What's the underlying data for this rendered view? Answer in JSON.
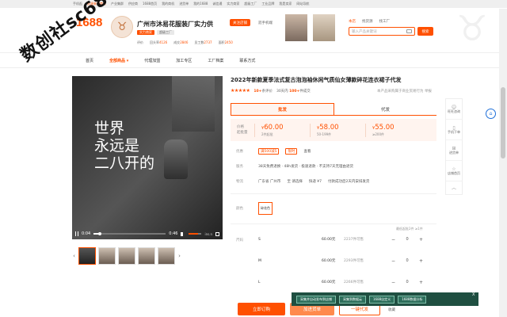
{
  "topbar": {
    "items": [
      "手机逛",
      "资源来源商家",
      "产业集群",
      "供应商",
      "1688首页",
      "我的商机",
      "进货单",
      "我的1688",
      "诚信通",
      "实力商家",
      "超级工厂",
      "工业品牌",
      "我是卖家",
      "网站导航"
    ]
  },
  "header": {
    "logo": "1688",
    "avatar_icon": "bull-avatar-icon",
    "shop_name": "广州市沐易花服装厂实力供",
    "follow_label": "关注店铺",
    "phone_label": "逛手机端",
    "badges": [
      "实力商家",
      "超级工厂"
    ],
    "stats": [
      {
        "label": "评价",
        "value": ""
      },
      {
        "label": "回头率",
        "value": "4126"
      },
      {
        "label": "成交",
        "value": "2846"
      },
      {
        "label": "员工数",
        "value": "2737"
      },
      {
        "label": "面积",
        "value": "2450"
      }
    ],
    "search_tabs": [
      "本店",
      "找货源",
      "找工厂"
    ],
    "search_placeholder": "输入产品关键词",
    "search_button": "搜索"
  },
  "nav": {
    "items": [
      "首页",
      "全部商品",
      "代理加盟",
      "加工专区",
      "工厂档案",
      "联系方式"
    ],
    "active_index": 1
  },
  "watermark": "数创社sc686",
  "video": {
    "title_line1": "世界",
    "title_line2": "永远是",
    "title_line3": "二八开的",
    "current_time": "0:04",
    "duration": "0:46",
    "progress": 0.09,
    "volume": 0.7,
    "watermark_text": "ins.n"
  },
  "thumbs": {
    "count": 5,
    "active_index": 0
  },
  "product": {
    "title": "2022年新款夏季法式复古泡泡袖休闲气质仙女薄款碎花连衣裙子代发",
    "stars": "★★★★★",
    "review_count": "10+",
    "review_label": "条评价",
    "sold_label": "30天内",
    "sold_count": "100+",
    "sold_suffix": "件成交",
    "right_note": "本产品采购属于商业贸易行为",
    "report_label": "举报"
  },
  "tabs": [
    {
      "label": "批发",
      "active": true
    },
    {
      "label": "代发",
      "active": false
    }
  ],
  "price": {
    "label": "价格",
    "label2": "起批量",
    "tiers": [
      {
        "price": "60.00",
        "range": "2件起批"
      },
      {
        "price": "58.00",
        "range": "50-199件"
      },
      {
        "price": "55.00",
        "range": "≥200件"
      }
    ],
    "currency": "¥"
  },
  "info": {
    "benefit_label": "优惠",
    "benefit_tag": "满500减5",
    "benefit_tag2": "限时",
    "benefit_more": "查看",
    "service_label": "服务",
    "service_text": "38天免费退换 · 48h发货 · 极速退款 · 不支持7天无理由退货",
    "logistics_label": "物流",
    "logistics_from": "广东省 广州市",
    "logistics_to": "至 请选择",
    "logistics_fee": "快递 ¥7",
    "logistics_note": "付款成功后2天内安排发货"
  },
  "color": {
    "label": "颜色",
    "options": [
      "碎花色"
    ]
  },
  "sizes": {
    "label": "尺码",
    "stock_note": "最低起批2件 ≥1件",
    "rows": [
      {
        "size": "S",
        "price": "60.00元",
        "stock": "2237件可售",
        "qty": "0"
      },
      {
        "size": "M",
        "price": "60.00元",
        "stock": "2293件可售",
        "qty": "0"
      },
      {
        "size": "L",
        "price": "60.00元",
        "stock": "2266件可售",
        "qty": "0"
      }
    ]
  },
  "actions": {
    "buy_now": "立即订购",
    "add_cart": "加进货单",
    "dropship": "一键代发",
    "favorite": "收藏"
  },
  "side_tools": [
    {
      "icon": "chat-icon",
      "label": "旺旺咨询"
    },
    {
      "icon": "phone-icon",
      "label": "手机下单"
    },
    {
      "icon": "cart-icon",
      "label": "进货单"
    },
    {
      "icon": "star-icon",
      "label": "店铺首页"
    }
  ],
  "extension": {
    "buttons": [
      "采集并自动发布到店铺",
      "采集到数据云",
      "1688自定义",
      "1688数据分析"
    ],
    "close": "X"
  },
  "colors": {
    "accent": "#ff5000",
    "ext_bar": "#1f4f41"
  }
}
